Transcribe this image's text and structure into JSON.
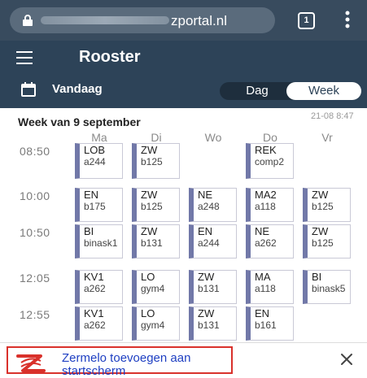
{
  "browser": {
    "url_domain": "zportal.nl",
    "tab_count": "1"
  },
  "header": {
    "title": "Rooster",
    "today_label": "Vandaag",
    "view_day": "Dag",
    "view_week": "Week"
  },
  "schedule": {
    "week_title": "Week van 9 september",
    "timestamp": "21-08 8:47",
    "days": [
      "Ma",
      "Di",
      "Wo",
      "Do",
      "Vr"
    ],
    "times": [
      "08:50",
      "10:00",
      "10:50",
      "12:05",
      "12:55"
    ],
    "lessons": [
      {
        "subject": "LOB",
        "room": "a244"
      },
      {
        "subject": "ZW",
        "room": "b125"
      },
      {
        "subject": "REK",
        "room": "comp2"
      },
      {
        "subject": "EN",
        "room": "b175"
      },
      {
        "subject": "ZW",
        "room": "b125"
      },
      {
        "subject": "NE",
        "room": "a248"
      },
      {
        "subject": "MA2",
        "room": "a118"
      },
      {
        "subject": "ZW",
        "room": "b125"
      },
      {
        "subject": "BI",
        "room": "binask1"
      },
      {
        "subject": "ZW",
        "room": "b131"
      },
      {
        "subject": "EN",
        "room": "a244"
      },
      {
        "subject": "NE",
        "room": "a262"
      },
      {
        "subject": "ZW",
        "room": "b125"
      },
      {
        "subject": "KV1",
        "room": "a262"
      },
      {
        "subject": "LO",
        "room": "gym4"
      },
      {
        "subject": "ZW",
        "room": "b131"
      },
      {
        "subject": "MA",
        "room": "a118"
      },
      {
        "subject": "BI",
        "room": "binask5"
      },
      {
        "subject": "KV1",
        "room": "a262"
      },
      {
        "subject": "LO",
        "room": "gym4"
      },
      {
        "subject": "ZW",
        "room": "b131"
      },
      {
        "subject": "EN",
        "room": "b161"
      }
    ]
  },
  "banner": {
    "text": "Zermelo toevoegen aan startscherm"
  },
  "colors": {
    "browser_bar": "#384b5e",
    "app_header": "#2d4358",
    "lesson_accent": "#7178a8",
    "banner_border": "#d9312b",
    "banner_text": "#1e3fc2"
  }
}
